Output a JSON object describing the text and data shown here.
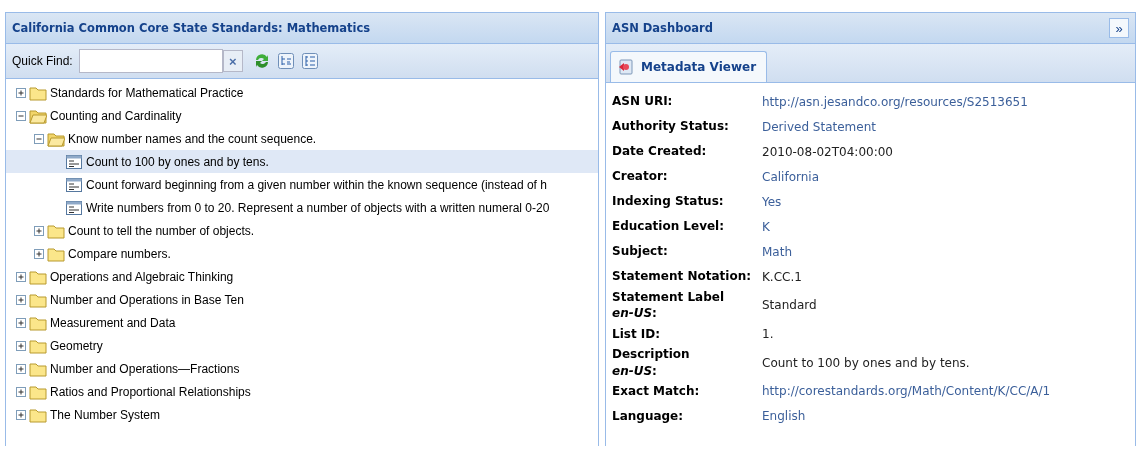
{
  "left_panel": {
    "title": "California Common Core State Standards: Mathematics",
    "quick_find": {
      "label": "Quick Find:",
      "clear": "×"
    },
    "tree": [
      {
        "label": "Standards for Mathematical Practice",
        "kind": "folder",
        "expanded": false,
        "selected": false
      },
      {
        "label": "Counting and Cardinality",
        "kind": "folder",
        "expanded": true,
        "selected": false,
        "children": [
          {
            "label": "Know number names and the count sequence.",
            "kind": "folder",
            "expanded": true,
            "selected": false,
            "children": [
              {
                "label": "Count to 100 by ones and by tens.",
                "kind": "leaf",
                "selected": true
              },
              {
                "label": "Count forward beginning from a given number within the known sequence (instead of h",
                "kind": "leaf",
                "selected": false
              },
              {
                "label": "Write numbers from 0 to 20. Represent a number of objects with a written numeral 0-20",
                "kind": "leaf",
                "selected": false
              }
            ]
          },
          {
            "label": "Count to tell the number of objects.",
            "kind": "folder",
            "expanded": false,
            "selected": false
          },
          {
            "label": "Compare numbers.",
            "kind": "folder",
            "expanded": false,
            "selected": false
          }
        ]
      },
      {
        "label": "Operations and Algebraic Thinking",
        "kind": "folder",
        "expanded": false,
        "selected": false
      },
      {
        "label": "Number and Operations in Base Ten",
        "kind": "folder",
        "expanded": false,
        "selected": false
      },
      {
        "label": "Measurement and Data",
        "kind": "folder",
        "expanded": false,
        "selected": false
      },
      {
        "label": "Geometry",
        "kind": "folder",
        "expanded": false,
        "selected": false
      },
      {
        "label": "Number and Operations—Fractions",
        "kind": "folder",
        "expanded": false,
        "selected": false
      },
      {
        "label": "Ratios and Proportional Relationships",
        "kind": "folder",
        "expanded": false,
        "selected": false
      },
      {
        "label": "The Number System",
        "kind": "folder",
        "expanded": false,
        "selected": false
      }
    ]
  },
  "right_panel": {
    "title": "ASN Dashboard",
    "collapse": "»",
    "tabs": [
      {
        "label": "Metadata Viewer",
        "selected": true
      }
    ],
    "metadata": [
      {
        "label": "ASN URI:",
        "value": "http://asn.jesandco.org/resources/S2513651",
        "kind": "link"
      },
      {
        "label": "Authority Status:",
        "value": "Derived Statement",
        "kind": "link"
      },
      {
        "label": "Date Created:",
        "value": "2010-08-02T04:00:00",
        "kind": "text"
      },
      {
        "label": "Creator:",
        "value": "California",
        "kind": "link"
      },
      {
        "label": "Indexing Status:",
        "value": "Yes",
        "kind": "link"
      },
      {
        "label": "Education Level:",
        "value": "K",
        "kind": "link"
      },
      {
        "label": "Subject:",
        "value": "Math",
        "kind": "link"
      },
      {
        "label": "Statement Notation:",
        "value": "K.CC.1",
        "kind": "text"
      },
      {
        "label": "Statement Label\n*en-US*:",
        "value": "Standard",
        "kind": "text"
      },
      {
        "label": "List ID:",
        "value": "1.",
        "kind": "text"
      },
      {
        "label": "Description\n*en-US*:",
        "value": "Count to 100 by ones and by tens.",
        "kind": "text"
      },
      {
        "label": "Exact Match:",
        "value": "http://corestandards.org/Math/Content/K/CC/A/1",
        "kind": "link"
      },
      {
        "label": "Language:",
        "value": "English",
        "kind": "link"
      }
    ]
  }
}
